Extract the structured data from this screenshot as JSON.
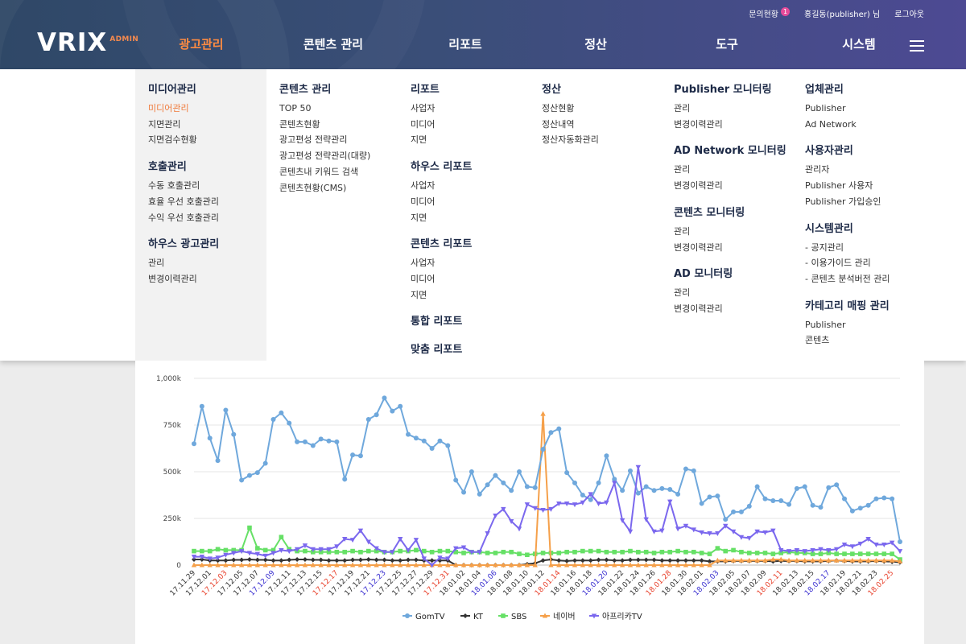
{
  "header": {
    "logo_text": "VRIX",
    "logo_sub": "ADMIN",
    "utility": {
      "inquiry": "문의현황",
      "inquiry_badge": "1",
      "user": "홍길동(publisher) 님",
      "logout": "로그아웃"
    },
    "gnb": [
      "광고관리",
      "콘텐츠 관리",
      "리포트",
      "정산",
      "도구",
      "시스템"
    ],
    "gnb_active": 0,
    "accent": "#ff8c42"
  },
  "mega_menu": [
    [
      {
        "title": "미디어관리",
        "items": [
          "미디어관리",
          "지면관리",
          "지면검수현황"
        ],
        "active_item": 0
      },
      {
        "title": "호출관리",
        "items": [
          "수동 호출관리",
          "효율 우선 호출관리",
          "수익 우선 호출관리"
        ]
      },
      {
        "title": "하우스 광고관리",
        "items": [
          "관리",
          "변경이력관리"
        ]
      }
    ],
    [
      {
        "title": "콘텐츠 관리",
        "items": [
          "TOP 50",
          "콘텐츠현황",
          "광고편성 전략관리",
          "광고편성 전략관리(대량)",
          "콘텐츠내 키워드 검색",
          "콘텐츠현황(CMS)"
        ]
      }
    ],
    [
      {
        "title": "리포트",
        "items": [
          "사업자",
          "미디어",
          "지면"
        ]
      },
      {
        "title": "하우스 리포트",
        "items": [
          "사업자",
          "미디어",
          "지면"
        ]
      },
      {
        "title": "콘텐츠 리포트",
        "items": [
          "사업자",
          "미디어",
          "지면"
        ]
      },
      {
        "title": "통합 리포트",
        "items": []
      },
      {
        "title": "맞춤 리포트",
        "items": []
      }
    ],
    [
      {
        "title": "정산",
        "items": [
          "정산현황",
          "정산내역",
          "정산자동화관리"
        ]
      }
    ],
    [
      {
        "title": "Publisher 모니터링",
        "items": [
          "관리",
          "변경이력관리"
        ]
      },
      {
        "title": "AD Network 모니터링",
        "items": [
          "관리",
          "변경이력관리"
        ]
      },
      {
        "title": "콘텐츠 모니터링",
        "items": [
          "관리",
          "변경이력관리"
        ]
      },
      {
        "title": "AD 모니터링",
        "items": [
          "관리",
          "변경이력관리"
        ]
      }
    ],
    [
      {
        "title": "업체관리",
        "items": [
          "Publisher",
          "Ad Network"
        ]
      },
      {
        "title": "사용자관리",
        "items": [
          "관리자",
          "Publisher 사용자",
          "Publisher 가입승인"
        ]
      },
      {
        "title": "시스템관리",
        "items": [
          "- 공지관리",
          "- 이용가이드 관리",
          "- 콘텐츠 분석버전 관리"
        ]
      },
      {
        "title": "카테고리 매핑 관리",
        "items": [
          "Publisher",
          "콘텐츠"
        ]
      }
    ]
  ],
  "chart_data": {
    "type": "line",
    "ylim": [
      0,
      1000000
    ],
    "y_ticks": [
      "0",
      "250k",
      "500k",
      "750k",
      "1,000k"
    ],
    "x": [
      "17.11.29",
      "17.11.30",
      "17.12.01",
      "17.12.02",
      "17.12.03",
      "17.12.04",
      "17.12.05",
      "17.12.06",
      "17.12.07",
      "17.12.08",
      "17.12.09",
      "17.12.10",
      "17.12.11",
      "17.12.12",
      "17.12.13",
      "17.12.14",
      "17.12.15",
      "17.12.16",
      "17.12.17",
      "17.12.18",
      "17.12.19",
      "17.12.20",
      "17.12.21",
      "17.12.22",
      "17.12.23",
      "17.12.24",
      "17.12.25",
      "17.12.26",
      "17.12.27",
      "17.12.28",
      "17.12.29",
      "17.12.30",
      "17.12.31",
      "18.01.01",
      "18.01.02",
      "18.01.03",
      "18.01.04",
      "18.01.05",
      "18.01.06",
      "18.01.07",
      "18.01.08",
      "18.01.09",
      "18.01.10",
      "18.01.11",
      "18.01.12",
      "18.01.13",
      "18.01.14",
      "18.01.15",
      "18.01.16",
      "18.01.17",
      "18.01.18",
      "18.01.19",
      "18.01.20",
      "18.01.21",
      "18.01.22",
      "18.01.23",
      "18.01.24",
      "18.01.25",
      "18.01.26",
      "18.01.27",
      "18.01.28",
      "18.01.29",
      "18.01.30",
      "18.01.31",
      "18.02.01",
      "18.02.02",
      "18.02.03",
      "18.02.04",
      "18.02.05",
      "18.02.06",
      "18.02.07",
      "18.02.08",
      "18.02.09",
      "18.02.10",
      "18.02.11",
      "18.02.12",
      "18.02.13",
      "18.02.14",
      "18.02.15",
      "18.02.16",
      "18.02.17",
      "18.02.18",
      "18.02.19",
      "18.02.20",
      "18.02.21",
      "18.02.22",
      "18.02.23",
      "18.02.24",
      "18.02.25",
      "18.02.26"
    ],
    "x_tick_labels": [
      "17.11.29",
      "17.12.01",
      "17.12.03",
      "17.12.05",
      "17.12.07",
      "17.12.09",
      "17.12.11",
      "17.12.13",
      "17.12.15",
      "17.12.17",
      "17.12.19",
      "17.12.21",
      "17.12.23",
      "17.12.25",
      "17.12.27",
      "17.12.29",
      "17.12.31",
      "18.01.02",
      "18.01.04",
      "18.01.06",
      "18.01.08",
      "18.01.10",
      "18.01.12",
      "18.01.14",
      "18.01.16",
      "18.01.18",
      "18.01.20",
      "18.01.22",
      "18.01.24",
      "18.01.26",
      "18.01.28",
      "18.01.30",
      "18.02.01",
      "18.02.03",
      "18.02.05",
      "18.02.07",
      "18.02.09",
      "18.02.11",
      "18.02.13",
      "18.02.15",
      "18.02.17",
      "18.02.19",
      "18.02.21",
      "18.02.23",
      "18.02.25"
    ],
    "x_tick_colors": [
      "#333",
      "#333",
      "#e8412c",
      "#333",
      "#333",
      "#3a2fd0",
      "#333",
      "#333",
      "#333",
      "#e8412c",
      "#333",
      "#333",
      "#3a2fd0",
      "#333",
      "#333",
      "#333",
      "#e8412c",
      "#333",
      "#333",
      "#3a2fd0",
      "#333",
      "#333",
      "#333",
      "#e8412c",
      "#333",
      "#333",
      "#3a2fd0",
      "#333",
      "#333",
      "#333",
      "#e8412c",
      "#333",
      "#333",
      "#3a2fd0",
      "#333",
      "#333",
      "#333",
      "#e8412c",
      "#333",
      "#333",
      "#3a2fd0",
      "#333",
      "#333",
      "#333",
      "#e8412c"
    ],
    "series": [
      {
        "name": "GomTV",
        "color": "#6fa8dc",
        "marker": "circle",
        "values": [
          650000,
          850000,
          680000,
          560000,
          830000,
          700000,
          455000,
          480000,
          495000,
          545000,
          780000,
          815000,
          760000,
          660000,
          660000,
          640000,
          675000,
          665000,
          660000,
          460000,
          590000,
          585000,
          780000,
          805000,
          895000,
          825000,
          850000,
          700000,
          680000,
          665000,
          625000,
          665000,
          640000,
          455000,
          390000,
          500000,
          380000,
          430000,
          480000,
          440000,
          400000,
          500000,
          420000,
          415000,
          620000,
          710000,
          730000,
          495000,
          440000,
          375000,
          350000,
          440000,
          585000,
          460000,
          400000,
          505000,
          385000,
          420000,
          400000,
          410000,
          405000,
          380000,
          515000,
          505000,
          330000,
          365000,
          370000,
          245000,
          285000,
          285000,
          315000,
          420000,
          355000,
          345000,
          345000,
          325000,
          410000,
          420000,
          320000,
          310000,
          415000,
          430000,
          355000,
          290000,
          305000,
          320000,
          355000,
          360000,
          355000,
          125000
        ]
      },
      {
        "name": "KT",
        "color": "#333333",
        "marker": "diamond",
        "values": [
          30000,
          30000,
          25000,
          25000,
          25000,
          28000,
          28000,
          30000,
          28000,
          28000,
          25000,
          25000,
          28000,
          30000,
          30000,
          28000,
          28000,
          25000,
          25000,
          25000,
          28000,
          28000,
          30000,
          28000,
          28000,
          25000,
          25000,
          28000,
          28000,
          25000,
          25000,
          25000,
          25000,
          0,
          0,
          0,
          0,
          0,
          0,
          0,
          0,
          0,
          5000,
          10000,
          25000,
          30000,
          25000,
          22000,
          25000,
          25000,
          25000,
          28000,
          28000,
          25000,
          25000,
          28000,
          28000,
          28000,
          28000,
          25000,
          25000,
          25000,
          25000,
          25000,
          25000,
          20000,
          20000,
          20000,
          22000,
          22000,
          22000,
          22000,
          22000,
          20000,
          22000,
          22000,
          22000,
          20000,
          20000,
          20000,
          22000,
          25000,
          22000,
          20000,
          20000,
          20000,
          22000,
          20000,
          18000,
          15000
        ]
      },
      {
        "name": "SBS",
        "color": "#66e066",
        "marker": "square",
        "values": [
          75000,
          75000,
          75000,
          85000,
          80000,
          80000,
          80000,
          200000,
          90000,
          80000,
          80000,
          150000,
          85000,
          75000,
          75000,
          70000,
          70000,
          70000,
          70000,
          70000,
          75000,
          70000,
          75000,
          75000,
          70000,
          70000,
          75000,
          75000,
          80000,
          75000,
          70000,
          75000,
          75000,
          70000,
          65000,
          70000,
          70000,
          65000,
          65000,
          70000,
          70000,
          60000,
          55000,
          60000,
          65000,
          65000,
          65000,
          70000,
          70000,
          75000,
          75000,
          75000,
          70000,
          70000,
          70000,
          75000,
          70000,
          70000,
          65000,
          70000,
          70000,
          75000,
          70000,
          70000,
          65000,
          60000,
          90000,
          75000,
          80000,
          70000,
          65000,
          65000,
          65000,
          60000,
          65000,
          70000,
          65000,
          65000,
          60000,
          60000,
          65000,
          60000,
          60000,
          60000,
          60000,
          60000,
          60000,
          60000,
          60000,
          30000
        ]
      },
      {
        "name": "네이버",
        "color": "#f5a04a",
        "marker": "triangle",
        "values": [
          0,
          0,
          0,
          0,
          0,
          0,
          0,
          0,
          0,
          0,
          0,
          0,
          0,
          0,
          0,
          0,
          0,
          0,
          0,
          0,
          0,
          0,
          0,
          0,
          0,
          0,
          0,
          0,
          0,
          0,
          0,
          0,
          0,
          0,
          0,
          0,
          0,
          0,
          0,
          0,
          0,
          0,
          0,
          0,
          810000,
          0,
          0,
          0,
          0,
          0,
          0,
          0,
          0,
          0,
          0,
          0,
          0,
          0,
          0,
          0,
          0,
          0,
          0,
          0,
          0,
          0,
          25000,
          25000,
          25000,
          25000,
          25000,
          25000,
          25000,
          30000,
          30000,
          25000,
          25000,
          25000,
          25000,
          25000,
          25000,
          25000,
          25000,
          25000,
          25000,
          25000,
          25000,
          25000,
          25000,
          20000
        ]
      },
      {
        "name": "아프리카TV",
        "color": "#7b68ee",
        "marker": "invtriangle",
        "values": [
          45000,
          45000,
          35000,
          40000,
          55000,
          65000,
          75000,
          65000,
          60000,
          50000,
          65000,
          80000,
          75000,
          85000,
          105000,
          85000,
          85000,
          85000,
          100000,
          140000,
          135000,
          185000,
          125000,
          90000,
          70000,
          70000,
          140000,
          80000,
          135000,
          35000,
          0,
          40000,
          35000,
          90000,
          95000,
          70000,
          70000,
          170000,
          265000,
          300000,
          235000,
          195000,
          325000,
          305000,
          295000,
          300000,
          330000,
          330000,
          325000,
          335000,
          380000,
          330000,
          335000,
          440000,
          240000,
          180000,
          525000,
          245000,
          180000,
          185000,
          340000,
          195000,
          210000,
          190000,
          175000,
          170000,
          170000,
          210000,
          180000,
          150000,
          145000,
          180000,
          175000,
          185000,
          80000,
          75000,
          80000,
          75000,
          80000,
          85000,
          80000,
          85000,
          110000,
          100000,
          115000,
          140000,
          110000,
          110000,
          120000,
          75000
        ]
      }
    ]
  }
}
